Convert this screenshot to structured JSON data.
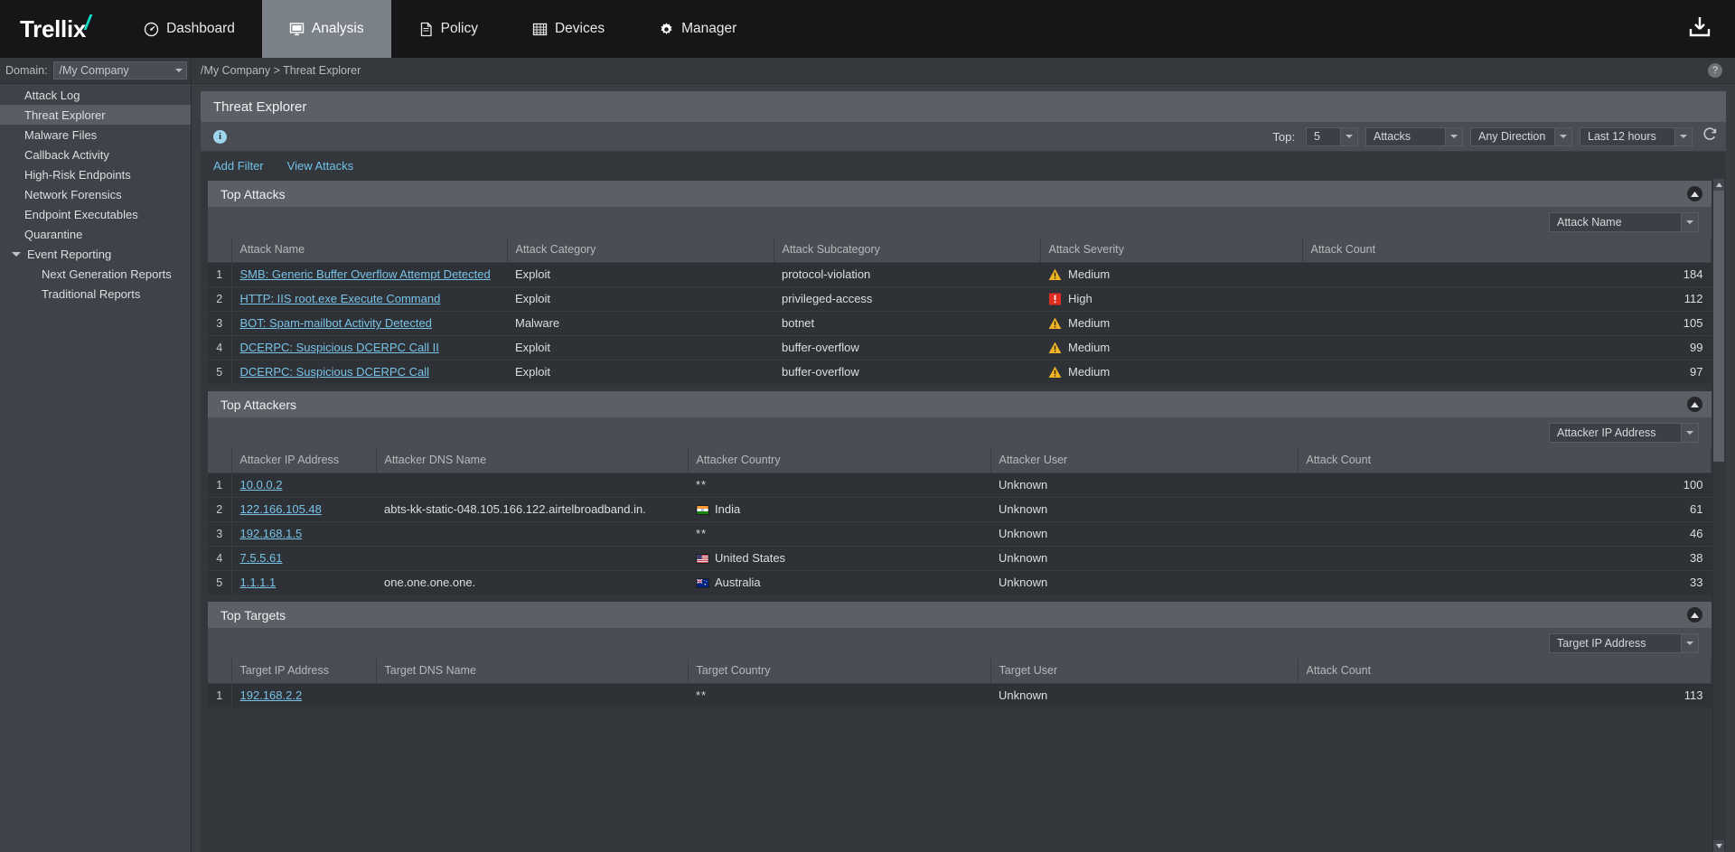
{
  "app": {
    "brand": "Trellix",
    "nav": [
      {
        "label": "Dashboard",
        "icon": "gauge-icon",
        "active": false
      },
      {
        "label": "Analysis",
        "icon": "monitor-icon",
        "active": true
      },
      {
        "label": "Policy",
        "icon": "document-icon",
        "active": false
      },
      {
        "label": "Devices",
        "icon": "grid-icon",
        "active": false
      },
      {
        "label": "Manager",
        "icon": "gear-icon",
        "active": false
      }
    ],
    "download_icon": "download-icon"
  },
  "sidebar": {
    "domain_label": "Domain:",
    "domain_value": "/My Company",
    "items": [
      {
        "label": "Attack Log",
        "level": 0,
        "active": false,
        "group": false
      },
      {
        "label": "Threat Explorer",
        "level": 0,
        "active": true,
        "group": false
      },
      {
        "label": "Malware Files",
        "level": 0,
        "active": false,
        "group": false
      },
      {
        "label": "Callback Activity",
        "level": 0,
        "active": false,
        "group": false
      },
      {
        "label": "High-Risk Endpoints",
        "level": 0,
        "active": false,
        "group": false
      },
      {
        "label": "Network Forensics",
        "level": 0,
        "active": false,
        "group": false
      },
      {
        "label": "Endpoint Executables",
        "level": 0,
        "active": false,
        "group": false
      },
      {
        "label": "Quarantine",
        "level": 0,
        "active": false,
        "group": false
      },
      {
        "label": "Event Reporting",
        "level": 0,
        "active": false,
        "group": true
      },
      {
        "label": "Next Generation Reports",
        "level": 1,
        "active": false,
        "group": false
      },
      {
        "label": "Traditional Reports",
        "level": 1,
        "active": false,
        "group": false
      }
    ]
  },
  "breadcrumb": "/My Company > Threat Explorer",
  "help_icon_label": "?",
  "page": {
    "title": "Threat Explorer",
    "toolbar": {
      "info_icon": "info-icon",
      "top_label": "Top:",
      "top_count": "5",
      "type": "Attacks",
      "direction": "Any Direction",
      "time_range": "Last 12 hours",
      "refresh_icon": "refresh-icon"
    },
    "links": [
      {
        "label": "Add Filter"
      },
      {
        "label": "View Attacks"
      }
    ]
  },
  "sections": [
    {
      "title": "Top Attacks",
      "collapse_icon": "chevron-up-icon",
      "filter_value": "Attack Name",
      "columns": [
        "Attack Name",
        "Attack Category",
        "Attack Subcategory",
        "Attack Severity",
        "Attack Count"
      ],
      "rows": [
        {
          "idx": "1",
          "name": "SMB: Generic Buffer Overflow Attempt Detected",
          "category": "Exploit",
          "subcategory": "protocol-violation",
          "severity": "Medium",
          "severity_level": "medium",
          "count": "184"
        },
        {
          "idx": "2",
          "name": "HTTP: IIS root.exe Execute Command",
          "category": "Exploit",
          "subcategory": "privileged-access",
          "severity": "High",
          "severity_level": "high",
          "count": "112"
        },
        {
          "idx": "3",
          "name": "BOT: Spam-mailbot Activity Detected",
          "category": "Malware",
          "subcategory": "botnet",
          "severity": "Medium",
          "severity_level": "medium",
          "count": "105"
        },
        {
          "idx": "4",
          "name": "DCERPC: Suspicious DCERPC Call II",
          "category": "Exploit",
          "subcategory": "buffer-overflow",
          "severity": "Medium",
          "severity_level": "medium",
          "count": "99"
        },
        {
          "idx": "5",
          "name": "DCERPC: Suspicious DCERPC Call",
          "category": "Exploit",
          "subcategory": "buffer-overflow",
          "severity": "Medium",
          "severity_level": "medium",
          "count": "97"
        }
      ]
    },
    {
      "title": "Top Attackers",
      "collapse_icon": "chevron-up-icon",
      "filter_value": "Attacker IP Address",
      "columns": [
        "Attacker IP Address",
        "Attacker DNS Name",
        "Attacker Country",
        "Attacker User",
        "Attack Count"
      ],
      "rows": [
        {
          "idx": "1",
          "ip": "10.0.0.2",
          "dns": "",
          "country": "**",
          "country_flag": "none",
          "user": "Unknown",
          "count": "100"
        },
        {
          "idx": "2",
          "ip": "122.166.105.48",
          "dns": "abts-kk-static-048.105.166.122.airtelbroadband.in.",
          "country": "India",
          "country_flag": "india",
          "user": "Unknown",
          "count": "61"
        },
        {
          "idx": "3",
          "ip": "192.168.1.5",
          "dns": "",
          "country": "**",
          "country_flag": "none",
          "user": "Unknown",
          "count": "46"
        },
        {
          "idx": "4",
          "ip": "7.5.5.61",
          "dns": "",
          "country": "United States",
          "country_flag": "usa",
          "user": "Unknown",
          "count": "38"
        },
        {
          "idx": "5",
          "ip": "1.1.1.1",
          "dns": "one.one.one.one.",
          "country": "Australia",
          "country_flag": "australia",
          "user": "Unknown",
          "count": "33"
        }
      ]
    },
    {
      "title": "Top Targets",
      "collapse_icon": "chevron-up-icon",
      "filter_value": "Target IP Address",
      "columns": [
        "Target IP Address",
        "Target DNS Name",
        "Target Country",
        "Target User",
        "Attack Count"
      ],
      "rows": [
        {
          "idx": "1",
          "ip": "192.168.2.2",
          "dns": "",
          "country": "**",
          "country_flag": "none",
          "user": "Unknown",
          "count": "113"
        }
      ]
    }
  ],
  "colors": {
    "accent_teal": "#0fd9c4",
    "link_blue": "#79c3e9",
    "severity_medium": "#f0b429",
    "severity_high": "#e02b20",
    "nav_active_bg": "#7b8189"
  }
}
